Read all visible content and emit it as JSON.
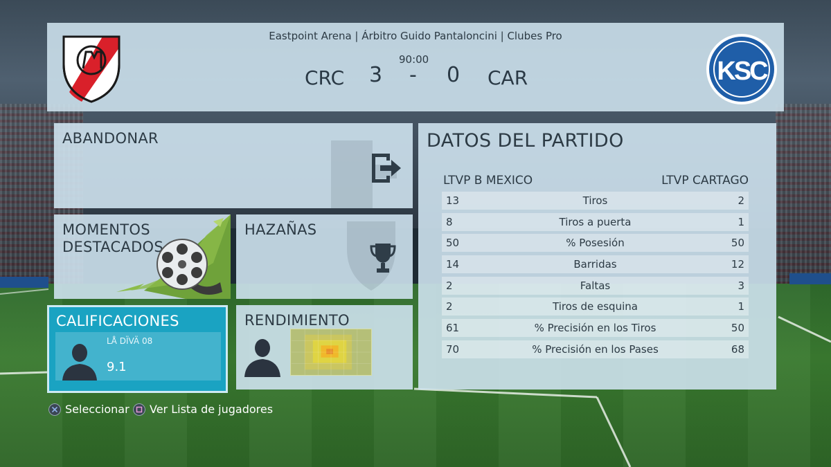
{
  "header": {
    "venue_line": "Eastpoint Arena | Árbitro Guido Pantaloncini | Clubes Pro",
    "clock": "90:00",
    "home_abbr": "CRC",
    "away_abbr": "CAR",
    "home_score": "3",
    "score_separator": "-",
    "away_score": "0",
    "away_crest_text": "KSC"
  },
  "menu": {
    "abandon_label": "ABANDONAR",
    "moments_label_line1": "MOMENTOS",
    "moments_label_line2": "DESTACADOS",
    "feats_label": "HAZAÑAS",
    "ratings_label": "CALIFICACIONES",
    "performance_label": "RENDIMIENTO"
  },
  "ratings": {
    "player_name": "LÅ DÏVÄ 08",
    "player_rating": "9.1"
  },
  "stats": {
    "title": "DATOS DEL PARTIDO",
    "home_team": "LTVP B MEXICO",
    "away_team": "LTVP CARTAGO",
    "rows": [
      {
        "home": "13",
        "label": "Tiros",
        "away": "2"
      },
      {
        "home": "8",
        "label": "Tiros a puerta",
        "away": "1"
      },
      {
        "home": "50",
        "label": "% Posesión",
        "away": "50"
      },
      {
        "home": "14",
        "label": "Barridas",
        "away": "12"
      },
      {
        "home": "2",
        "label": "Faltas",
        "away": "3"
      },
      {
        "home": "2",
        "label": "Tiros de esquina",
        "away": "1"
      },
      {
        "home": "61",
        "label": "% Precisión en los Tiros",
        "away": "50"
      },
      {
        "home": "70",
        "label": "% Precisión en los Pases",
        "away": "68"
      }
    ]
  },
  "footer": {
    "select_hint": "Seleccionar",
    "players_hint": "Ver Lista de jugadores"
  },
  "icons": {
    "cross_button": "cross-button-icon",
    "square_button": "square-button-icon",
    "exit": "exit-icon",
    "trophy": "trophy-icon",
    "film_reel": "film-reel-icon"
  },
  "colors": {
    "panel": "#cee2ee",
    "selected_tile": "#1aa3c2",
    "text": "#2c3a44",
    "away_crest": "#1f5ea8",
    "home_crest_band": "#d9202a"
  }
}
